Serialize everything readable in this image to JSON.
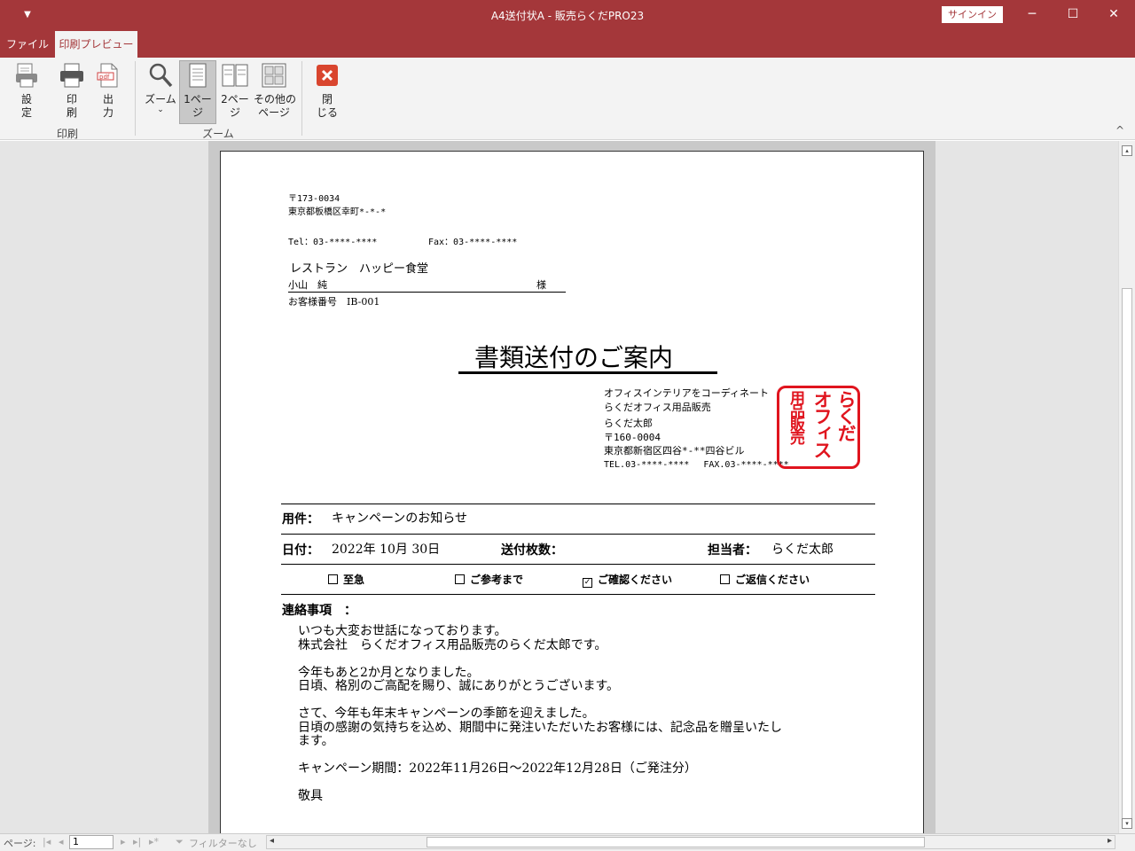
{
  "window": {
    "title": "A4送付状A  -  販売らくだPRO23",
    "signin": "サインイン",
    "qat_glyph": "▼",
    "min_glyph": "─",
    "max_glyph": "☐",
    "close_glyph": "✕"
  },
  "tabs": {
    "file": "ファイル",
    "preview": "印刷プレビュー"
  },
  "ribbon": {
    "settings": "設\n定",
    "print": "印\n刷",
    "output": "出\n力",
    "print_group": "印刷",
    "zoom": "ズーム",
    "one_page": "1ペー\nジ",
    "two_page": "2ペー\nジ",
    "other_pages": "その他の\nページ",
    "zoom_group": "ズーム",
    "close": "閉\nじる",
    "collapse_glyph": "^"
  },
  "document": {
    "sender_zip": "〒173-0034",
    "sender_addr": "東京都板橋区幸町*-*-*",
    "tel": "Tel：03-****-****",
    "fax": "Fax：03-****-****",
    "recipient_company": "レストラン　ハッピー食堂",
    "recipient_name": "小山　純",
    "honorific": "様",
    "customer_no": "お客様番号　IB-001",
    "heading": "書類送付のご案内",
    "from_line1": "オフィスインテリアをコーディネート",
    "from_line2": "らくだオフィス用品販売",
    "from_person": "らくだ太郎",
    "from_zip": "〒160-0004",
    "from_addr": "東京都新宿区四谷*-**四谷ビル",
    "from_telfax": "TEL.03-****-****　 FAX.03-****-****",
    "stamp_cols": [
      "らくだ",
      "オフィス",
      "用品販売"
    ],
    "subject_label": "用件：",
    "subject_value": "キャンペーンのお知らせ",
    "date_label": "日付：",
    "date_value": "2022年 10月 30日",
    "sheets_label": "送付枚数：",
    "staff_label": "担当者：",
    "staff_value": "らくだ太郎",
    "checkboxes": [
      {
        "label": "至急",
        "checked": ""
      },
      {
        "label": "ご参考まで",
        "checked": ""
      },
      {
        "label": "ご確認ください",
        "checked": "✓"
      },
      {
        "label": "ご返信ください",
        "checked": ""
      }
    ],
    "notes_label": "連絡事項　：",
    "body": "いつも大変お世話になっております。\n株式会社　らくだオフィス用品販売のらくだ太郎です。\n\n今年もあと2か月となりました。\n日頃、格別のご高配を賜り、誠にありがとうございます。\n\nさて、今年も年末キャンペーンの季節を迎えました。\n日頃の感謝の気持ちを込め、期間中に発注いただいたお客様には、記念品を贈呈いたし\nます。\n\nキャンペーン期間：2022年11月26日～2022年12月28日（ご発注分）\n\n敬具"
  },
  "status": {
    "page_label": "ページ:",
    "page_value": "1",
    "nav_first": "|◂",
    "nav_prev": "◂",
    "nav_next": "▸",
    "nav_last": "▸|",
    "nav_new": "▸*",
    "filter": "フィルターなし",
    "scroll_left": "◂",
    "scroll_right": "▸",
    "scroll_up": "▴",
    "scroll_down": "▾"
  },
  "colors": {
    "accent": "#a4373a",
    "stamp": "#e0141e"
  }
}
